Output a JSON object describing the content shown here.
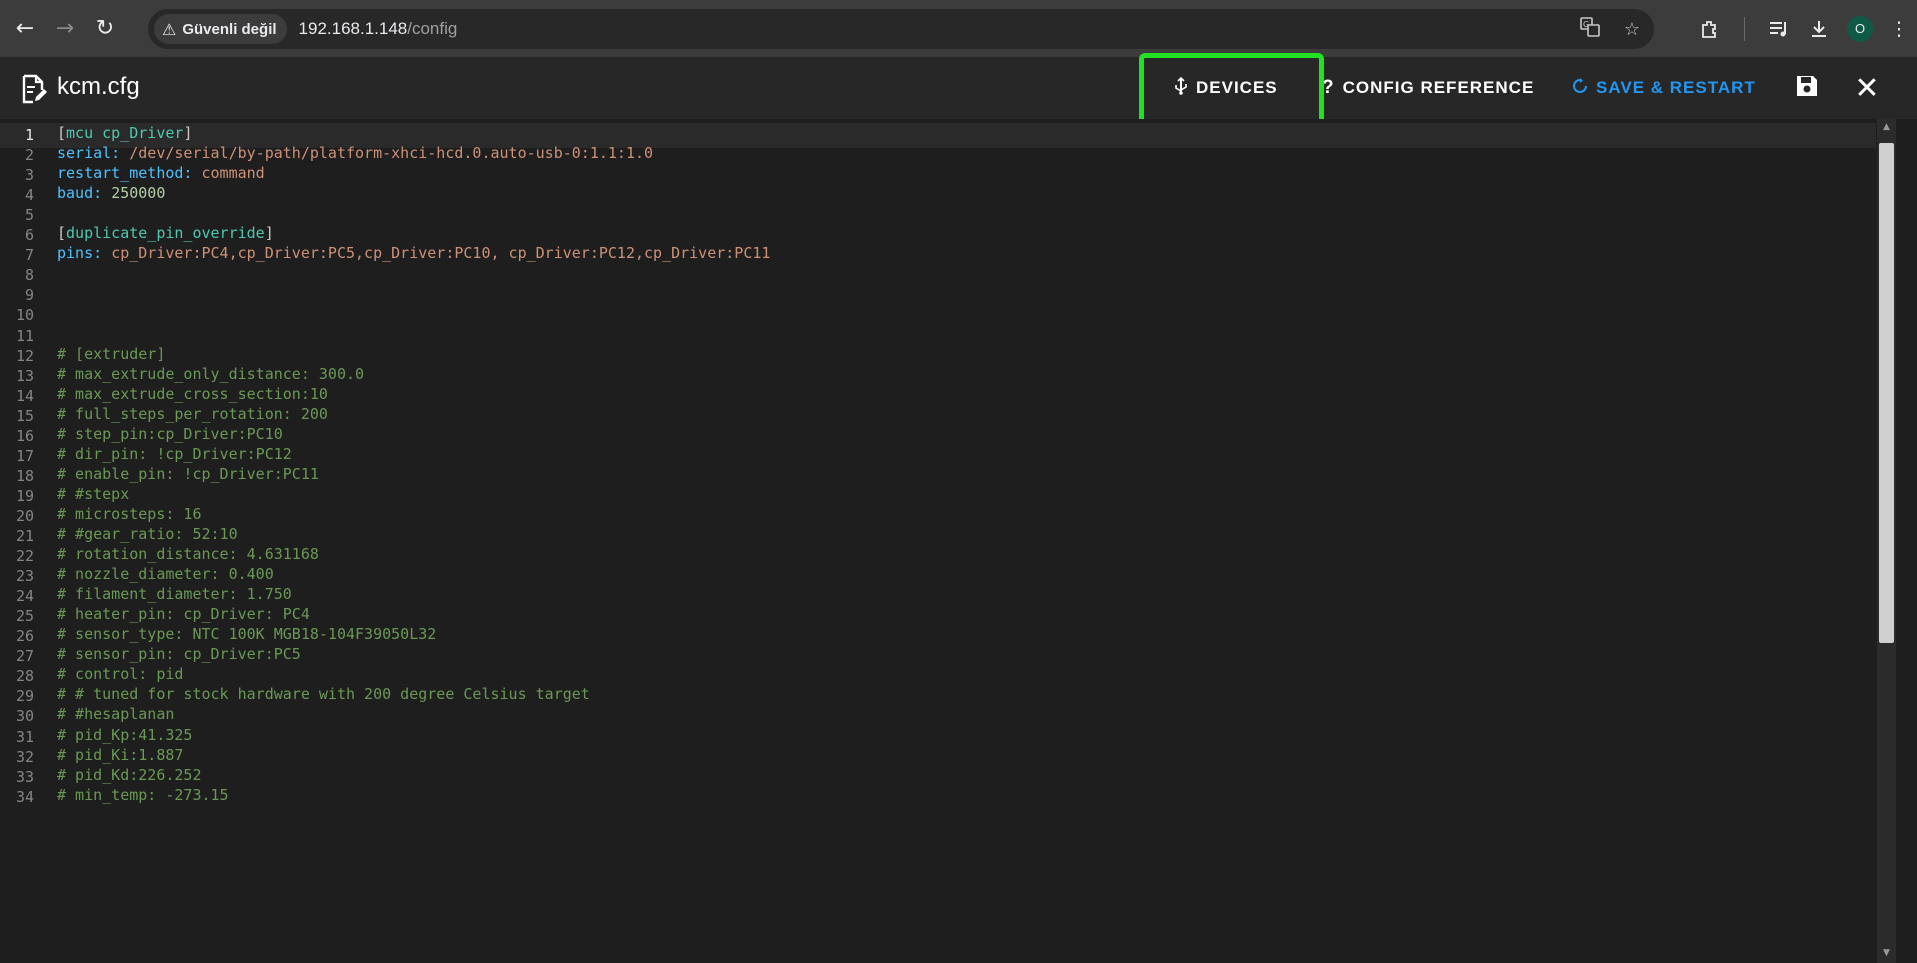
{
  "browser": {
    "security_label": "Güvenli değil",
    "url_host": "192.168.1.148",
    "url_path": "/config",
    "profile_initial": "O"
  },
  "app": {
    "file_name": "kcm.cfg",
    "devices_label": "DEVICES",
    "config_reference_label": "CONFIG REFERENCE",
    "save_restart_label": "SAVE & RESTART",
    "accent_color": "#2196f3",
    "highlight_color": "#22e022"
  },
  "editor": {
    "active_line": 1,
    "lines": [
      {
        "n": "1",
        "parts": [
          [
            "bracket",
            "["
          ],
          [
            "section",
            "mcu cp_Driver"
          ],
          [
            "bracket",
            "]"
          ]
        ]
      },
      {
        "n": "2",
        "parts": [
          [
            "key",
            "serial: "
          ],
          [
            "val",
            "/dev/serial/by-path/platform-xhci-hcd.0.auto-usb-0:1.1:1.0"
          ]
        ]
      },
      {
        "n": "3",
        "parts": [
          [
            "key",
            "restart_method: "
          ],
          [
            "val",
            "command"
          ]
        ]
      },
      {
        "n": "4",
        "parts": [
          [
            "key",
            "baud: "
          ],
          [
            "num",
            "250000"
          ]
        ]
      },
      {
        "n": "5",
        "parts": []
      },
      {
        "n": "6",
        "parts": [
          [
            "bracket",
            "["
          ],
          [
            "section",
            "duplicate_pin_override"
          ],
          [
            "bracket",
            "]"
          ]
        ]
      },
      {
        "n": "7",
        "parts": [
          [
            "key",
            "pins: "
          ],
          [
            "val",
            "cp_Driver:PC4,cp_Driver:PC5,cp_Driver:PC10, cp_Driver:PC12,cp_Driver:PC11"
          ]
        ]
      },
      {
        "n": "8",
        "parts": []
      },
      {
        "n": "9",
        "parts": []
      },
      {
        "n": "10",
        "parts": []
      },
      {
        "n": "11",
        "parts": []
      },
      {
        "n": "12",
        "parts": [
          [
            "comment",
            "# [extruder]"
          ]
        ]
      },
      {
        "n": "13",
        "parts": [
          [
            "comment",
            "# max_extrude_only_distance: 300.0"
          ]
        ]
      },
      {
        "n": "14",
        "parts": [
          [
            "comment",
            "# max_extrude_cross_section:10"
          ]
        ]
      },
      {
        "n": "15",
        "parts": [
          [
            "comment",
            "# full_steps_per_rotation: 200"
          ]
        ]
      },
      {
        "n": "16",
        "parts": [
          [
            "comment",
            "# step_pin:cp_Driver:PC10"
          ]
        ]
      },
      {
        "n": "17",
        "parts": [
          [
            "comment",
            "# dir_pin: !cp_Driver:PC12"
          ]
        ]
      },
      {
        "n": "18",
        "parts": [
          [
            "comment",
            "# enable_pin: !cp_Driver:PC11"
          ]
        ]
      },
      {
        "n": "19",
        "parts": [
          [
            "comment",
            "# #stepx"
          ]
        ]
      },
      {
        "n": "20",
        "parts": [
          [
            "comment",
            "# microsteps: 16"
          ]
        ]
      },
      {
        "n": "21",
        "parts": [
          [
            "comment",
            "# #gear_ratio: 52:10"
          ]
        ]
      },
      {
        "n": "22",
        "parts": [
          [
            "comment",
            "# rotation_distance: 4.631168"
          ]
        ]
      },
      {
        "n": "23",
        "parts": [
          [
            "comment",
            "# nozzle_diameter: 0.400"
          ]
        ]
      },
      {
        "n": "24",
        "parts": [
          [
            "comment",
            "# filament_diameter: 1.750"
          ]
        ]
      },
      {
        "n": "25",
        "parts": [
          [
            "comment",
            "# heater_pin: cp_Driver: PC4"
          ]
        ]
      },
      {
        "n": "26",
        "parts": [
          [
            "comment",
            "# sensor_type: NTC 100K MGB18-104F39050L32"
          ]
        ]
      },
      {
        "n": "27",
        "parts": [
          [
            "comment",
            "# sensor_pin: cp_Driver:PC5"
          ]
        ]
      },
      {
        "n": "28",
        "parts": [
          [
            "comment",
            "# control: pid"
          ]
        ]
      },
      {
        "n": "29",
        "parts": [
          [
            "comment",
            "# # tuned for stock hardware with 200 degree Celsius target"
          ]
        ]
      },
      {
        "n": "30",
        "parts": [
          [
            "comment",
            "# #hesaplanan"
          ]
        ]
      },
      {
        "n": "31",
        "parts": [
          [
            "comment",
            "# pid_Kp:41.325"
          ]
        ]
      },
      {
        "n": "32",
        "parts": [
          [
            "comment",
            "# pid_Ki:1.887"
          ]
        ]
      },
      {
        "n": "33",
        "parts": [
          [
            "comment",
            "# pid_Kd:226.252"
          ]
        ]
      },
      {
        "n": "34",
        "parts": [
          [
            "comment",
            "# min_temp: -273.15"
          ]
        ]
      }
    ]
  }
}
